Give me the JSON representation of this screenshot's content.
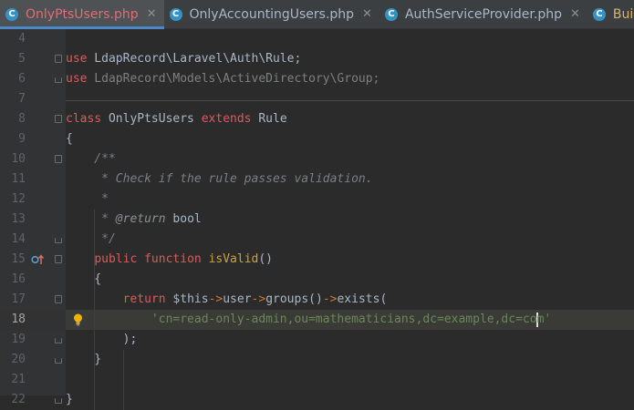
{
  "tabs": [
    {
      "label": "OnlyPtsUsers.php",
      "icon": "php-class-icon",
      "icon_letter": "C",
      "closable": true,
      "active": true
    },
    {
      "label": "OnlyAccountingUsers.php",
      "icon": "php-class-icon",
      "icon_letter": "C",
      "closable": true,
      "active": false
    },
    {
      "label": "AuthServiceProvider.php",
      "icon": "php-class-icon",
      "icon_letter": "C",
      "closable": true,
      "active": false
    },
    {
      "label": "Buil",
      "icon": "php-class-icon",
      "icon_letter": "C",
      "closable": false,
      "active": false
    }
  ],
  "close_glyph": "✕",
  "editor": {
    "current_line": 18,
    "lines": [
      {
        "num": "4",
        "parts": []
      },
      {
        "num": "5",
        "parts": [
          {
            "t": "use",
            "c": "kwr"
          },
          {
            "t": " LdapRecord\\Laravel\\Auth\\Rule;",
            "c": "plain"
          }
        ]
      },
      {
        "num": "6",
        "parts": [
          {
            "t": "use",
            "c": "kwr"
          },
          {
            "t": " LdapRecord\\Models\\ActiveDirectory\\Group;",
            "c": "ns-grey"
          }
        ]
      },
      {
        "num": "7",
        "parts": []
      },
      {
        "num": "8",
        "parts": [
          {
            "t": "class",
            "c": "kwr"
          },
          {
            "t": " OnlyPtsUsers ",
            "c": "plain"
          },
          {
            "t": "extends",
            "c": "kwr"
          },
          {
            "t": " Rule",
            "c": "plain"
          }
        ]
      },
      {
        "num": "9",
        "parts": [
          {
            "t": "{",
            "c": "plain"
          }
        ]
      },
      {
        "num": "10",
        "parts": [
          {
            "t": "    /**",
            "c": "cmt"
          }
        ]
      },
      {
        "num": "11",
        "parts": [
          {
            "t": "     * Check if the rule passes validation.",
            "c": "cmt"
          }
        ]
      },
      {
        "num": "12",
        "parts": [
          {
            "t": "     *",
            "c": "cmt"
          }
        ]
      },
      {
        "num": "13",
        "parts": [
          {
            "t": "     * ",
            "c": "cmt"
          },
          {
            "t": "@return",
            "c": "tag"
          },
          {
            "t": " bool",
            "c": "plain"
          }
        ]
      },
      {
        "num": "14",
        "parts": [
          {
            "t": "     */",
            "c": "cmt"
          }
        ]
      },
      {
        "num": "15",
        "parts": [
          {
            "t": "    ",
            "c": "plain"
          },
          {
            "t": "public",
            "c": "kwr"
          },
          {
            "t": " ",
            "c": "plain"
          },
          {
            "t": "function",
            "c": "kwr"
          },
          {
            "t": " ",
            "c": "plain"
          },
          {
            "t": "isValid",
            "c": "fn"
          },
          {
            "t": "()",
            "c": "plain"
          }
        ]
      },
      {
        "num": "16",
        "parts": [
          {
            "t": "    {",
            "c": "plain"
          }
        ]
      },
      {
        "num": "17",
        "parts": [
          {
            "t": "        ",
            "c": "plain"
          },
          {
            "t": "return",
            "c": "kwr"
          },
          {
            "t": " $this",
            "c": "plain"
          },
          {
            "t": "->",
            "c": "arrow"
          },
          {
            "t": "user",
            "c": "plain"
          },
          {
            "t": "->",
            "c": "arrow"
          },
          {
            "t": "groups",
            "c": "plain"
          },
          {
            "t": "()",
            "c": "plain"
          },
          {
            "t": "->",
            "c": "arrow"
          },
          {
            "t": "exists",
            "c": "plain"
          },
          {
            "t": "(",
            "c": "plain"
          }
        ]
      },
      {
        "num": "18",
        "parts": [
          {
            "t": "            ",
            "c": "plain"
          },
          {
            "t": "'cn=read-only-admin,ou=mathematicians,dc=example,dc=co",
            "c": "str"
          },
          {
            "t": "CARET",
            "c": "caret"
          },
          {
            "t": "m'",
            "c": "str"
          }
        ]
      },
      {
        "num": "19",
        "parts": [
          {
            "t": "        );",
            "c": "plain"
          }
        ]
      },
      {
        "num": "20",
        "parts": [
          {
            "t": "    }",
            "c": "plain"
          }
        ]
      },
      {
        "num": "21",
        "parts": []
      },
      {
        "num": "22",
        "parts": [
          {
            "t": "}",
            "c": "plain"
          }
        ]
      }
    ]
  },
  "colors": {
    "accent": "#4a88c7",
    "bulb": "#f0b400",
    "impl_marker": "#e06c5a",
    "impl_circle": "#5a9bd5"
  }
}
